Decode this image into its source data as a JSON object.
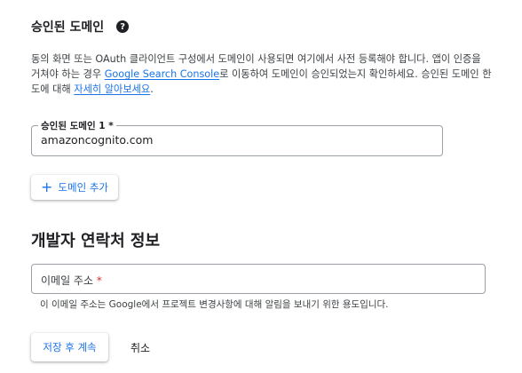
{
  "authorized_domains": {
    "title": "승인된 도메인",
    "help_icon": "?",
    "description_before_link1": "동의 화면 또는 OAuth 클라이언트 구성에서 도메인이 사용되면 여기에서 사전 등록해야 합니다. 앱이 인증을 거쳐야 하는 경우 ",
    "link_search_console": "Google Search Console",
    "description_between": "로 이동하여 도메인이 승인되었는지 확인하세요. 승인된 도메인 한도에 대해 ",
    "link_learn_more": "자세히 알아보세요",
    "description_after": ".",
    "domain_field": {
      "label": "승인된 도메인 1",
      "required_mark": "*",
      "value": "amazoncognito.com"
    },
    "add_domain_button": {
      "icon": "+",
      "label": "도메인 추가"
    }
  },
  "developer_contact": {
    "title": "개발자 연락처 정보",
    "email_field": {
      "placeholder": "이메일 주소",
      "required_mark": "*"
    },
    "hint": "이 이메일 주소는 Google에서 프로젝트 변경사항에 대해 알림을 보내기 위한 용도입니다."
  },
  "actions": {
    "save_label": "저장 후 계속",
    "cancel_label": "취소"
  },
  "colors": {
    "accent": "#1a73e8",
    "required": "#d93025",
    "text": "#202124"
  }
}
